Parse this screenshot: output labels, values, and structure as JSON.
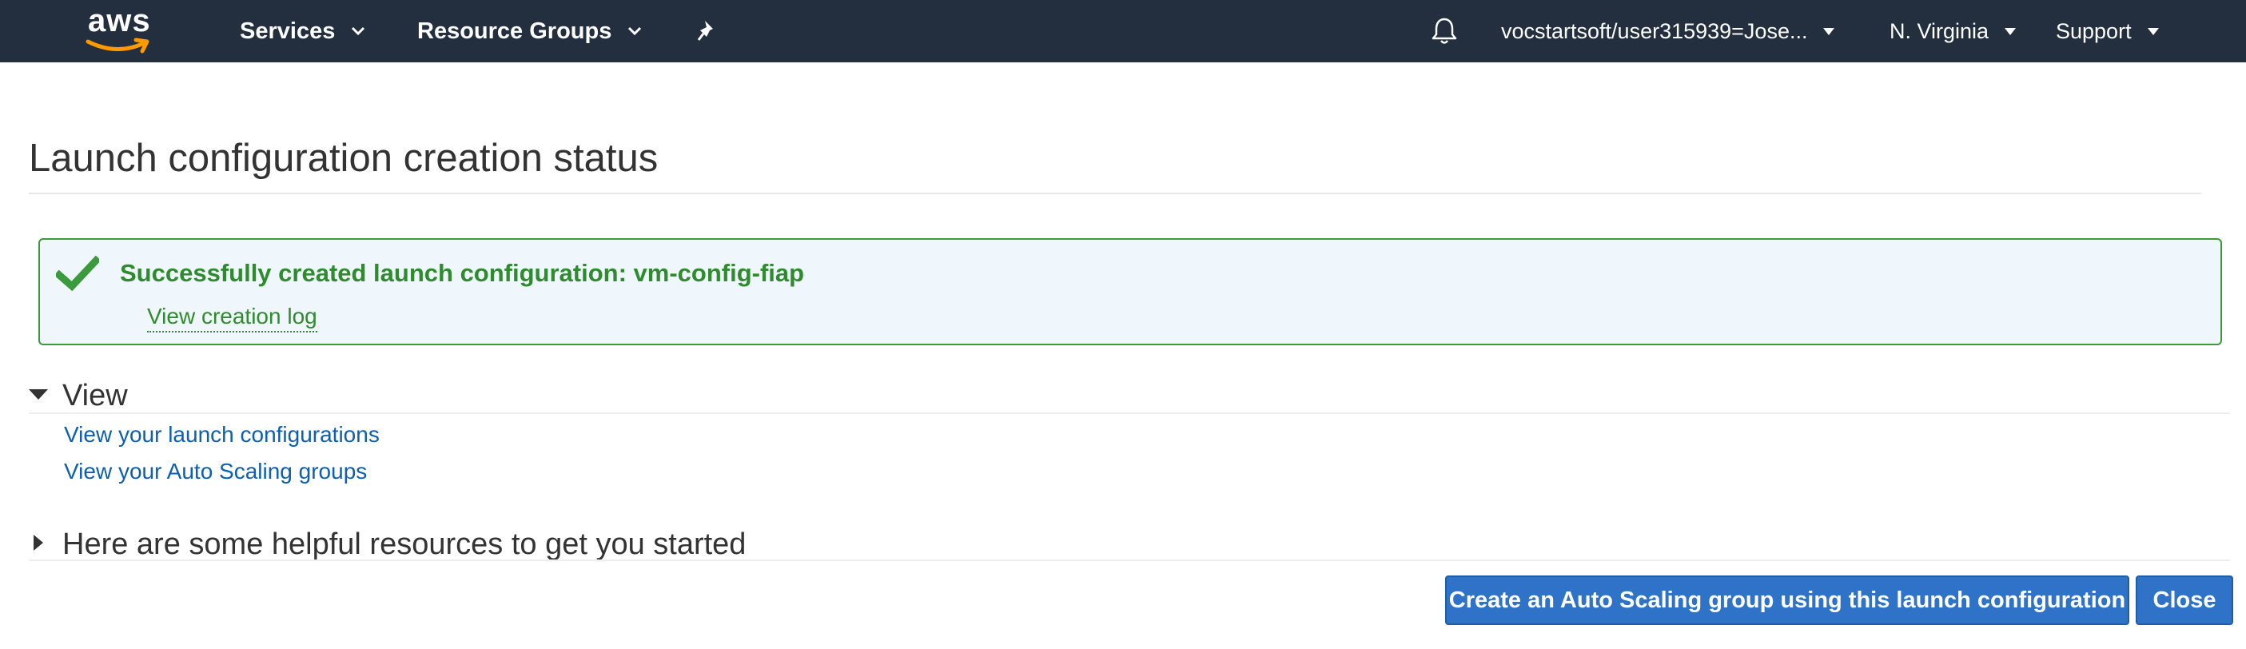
{
  "topbar": {
    "logo_text": "aws",
    "services_label": "Services",
    "resource_groups_label": "Resource Groups",
    "pin_icon": "pin-icon",
    "bell_icon": "bell-icon",
    "account_label": "vocstartsoft/user315939=Jose...",
    "region_label": "N. Virginia",
    "support_label": "Support",
    "background_color": "#232f3e"
  },
  "page": {
    "title": "Launch configuration creation status"
  },
  "success": {
    "message": "Successfully created launch configuration: vm-config-fiap",
    "log_link": "View creation log",
    "icon": "checkmark-icon",
    "color": "#2e8b2e"
  },
  "view_section": {
    "heading": "View",
    "links": [
      "View your launch configurations",
      "View your Auto Scaling groups"
    ]
  },
  "resources_section": {
    "heading": "Here are some helpful resources to get you started"
  },
  "actions": {
    "create_asg_label": "Create an Auto Scaling group using this launch configuration",
    "close_label": "Close",
    "button_color": "#2e73c7"
  }
}
